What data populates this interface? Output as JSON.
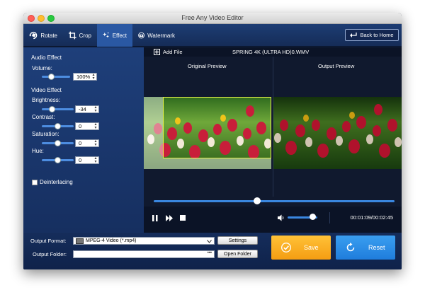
{
  "window": {
    "title": "Free Any Video Editor"
  },
  "toolbar": {
    "tabs": [
      {
        "label": "Rotate",
        "icon": "rotate-icon"
      },
      {
        "label": "Crop",
        "icon": "crop-icon"
      },
      {
        "label": "Effect",
        "icon": "effect-icon",
        "active": true
      },
      {
        "label": "Watermark",
        "icon": "watermark-icon"
      }
    ],
    "back_home": "Back to Home"
  },
  "effects": {
    "audio_heading": "Audio Effect",
    "volume_label": "Volume:",
    "volume_value": "100%",
    "video_heading": "Video Effect",
    "brightness_label": "Brightness:",
    "brightness_value": "-34",
    "contrast_label": "Contrast:",
    "contrast_value": "0",
    "saturation_label": "Saturation:",
    "saturation_value": "0",
    "hue_label": "Hue:",
    "hue_value": "0",
    "deinterlacing_label": "Deinterlacing",
    "deinterlacing_checked": false
  },
  "preview": {
    "add_file": "Add File",
    "file_name": "SPRING 4K (ULTRA HD)0.WMV",
    "original_label": "Original Preview",
    "output_label": "Output Preview",
    "seek_fraction": 0.43,
    "volume_fraction": 0.85,
    "time": "00:01:09/00:02:45"
  },
  "bottom": {
    "output_format_label": "Output Format:",
    "output_format_value": "MPEG-4 Video (*.mp4)",
    "settings_button": "Settings",
    "output_folder_label": "Output Folder:",
    "output_folder_value": "",
    "output_folder_dots": "•••",
    "open_folder_button": "Open Folder",
    "save_button": "Save",
    "reset_button": "Reset"
  },
  "colors": {
    "accent_blue": "#3a87e0",
    "save_orange": "#f5a623",
    "reset_blue": "#2b8de8",
    "crop_border": "#e6f24a"
  }
}
